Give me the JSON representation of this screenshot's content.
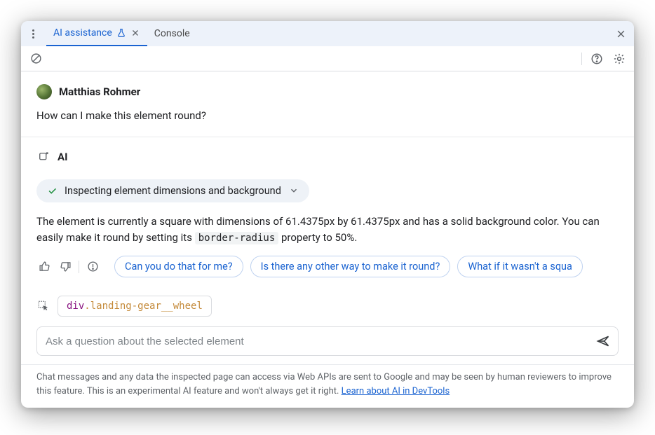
{
  "tabs": {
    "active": "AI assistance",
    "other": "Console"
  },
  "user": {
    "name": "Matthias Rohmer",
    "question": "How can I make this element round?"
  },
  "ai": {
    "label": "AI",
    "inspecting": "Inspecting element dimensions and background",
    "answer_pre": "The element is currently a square with dimensions of 61.4375px by 61.4375px and has a solid background color. You can easily make it round by setting its ",
    "answer_code": "border-radius",
    "answer_post": " property to 50%."
  },
  "suggestions": [
    "Can you do that for me?",
    "Is there any other way to make it round?",
    "What if it wasn't a squa"
  ],
  "element": {
    "tag": "div",
    "cls": ".landing-gear__wheel"
  },
  "input": {
    "placeholder": "Ask a question about the selected element"
  },
  "disclaimer": {
    "text": "Chat messages and any data the inspected page can access via Web APIs are sent to Google and may be seen by human reviewers to improve this feature. This is an experimental AI feature and won't always get it right. ",
    "link": "Learn about AI in DevTools"
  }
}
